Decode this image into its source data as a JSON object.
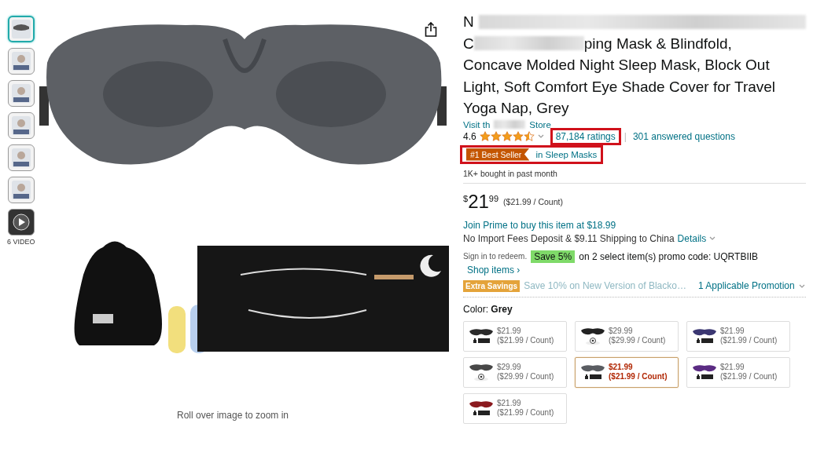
{
  "gallery": {
    "thumbnails": [
      {
        "kind": "photo",
        "selected": true
      },
      {
        "kind": "photo",
        "selected": false
      },
      {
        "kind": "photo",
        "selected": false
      },
      {
        "kind": "photo",
        "selected": false
      },
      {
        "kind": "photo",
        "selected": false
      },
      {
        "kind": "photo",
        "selected": false
      },
      {
        "kind": "video",
        "selected": false
      }
    ],
    "video_label": "6 VIDEO",
    "hint": "Roll over image to zoom in"
  },
  "product": {
    "title_lines": [
      [
        {
          "kind": "text",
          "text": "N"
        },
        {
          "kind": "blur_long"
        }
      ],
      [
        {
          "kind": "text",
          "text": "C"
        },
        {
          "kind": "blur_mid"
        },
        {
          "kind": "text",
          "text": "ping Mask & Blindfold,"
        }
      ],
      [
        {
          "kind": "text",
          "text": "Concave Molded Night Sleep Mask, Block Out"
        }
      ],
      [
        {
          "kind": "text",
          "text": "Light, Soft Comfort Eye Shade Cover for Travel"
        }
      ],
      [
        {
          "kind": "text",
          "text": "Yoga Nap, Grey"
        }
      ]
    ],
    "store_link": [
      {
        "kind": "text",
        "text": "Visit th"
      },
      {
        "kind": "blur_short"
      },
      {
        "kind": "text",
        "text": "Store"
      }
    ],
    "rating": "4.6",
    "stars": 4.5,
    "ratings_count": {
      "text": "87,184 ratings",
      "highlighted": true
    },
    "separator": "|",
    "answered": "301 answered questions",
    "badge": {
      "label": "#1 Best Seller",
      "category": "in Sleep Masks",
      "highlighted": true
    },
    "bought": "1K+ bought in past month"
  },
  "price": {
    "symbol": "$",
    "whole": "21",
    "fraction": "99",
    "unit": "($21.99 / Count)"
  },
  "prime": "Join Prime to buy this item at $18.99",
  "shipping": {
    "text": "No Import Fees Deposit & $9.11 Shipping to China",
    "link": "Details"
  },
  "promo": {
    "sign_in": "Sign in to redeem.",
    "badge": "Save 5%",
    "text": "on 2 select item(s) promo code: UQRTBIIB",
    "link": "Shop items ›"
  },
  "extra": {
    "badge": "Extra Savings",
    "text": "Save 10% on New Version of Blacko…",
    "link": "1 Applicable Promotion"
  },
  "color": {
    "label": "Color:",
    "value": "Grey"
  },
  "variants": [
    {
      "color": "#2b2b2b",
      "kind": "case",
      "price": "$21.99",
      "unit": "($21.99 / Count)",
      "selected": false
    },
    {
      "color": "#222222",
      "kind": "figure",
      "price": "$29.99",
      "unit": "($29.99 / Count)",
      "selected": false
    },
    {
      "color": "#3b3772",
      "kind": "case",
      "price": "$21.99",
      "unit": "($21.99 / Count)",
      "selected": false
    },
    {
      "color": "#474747",
      "kind": "figure",
      "price": "$29.99",
      "unit": "($29.99 / Count)",
      "selected": false
    },
    {
      "color": "#5a5d62",
      "kind": "case",
      "price": "$21.99",
      "unit": "($21.99 / Count)",
      "selected": true
    },
    {
      "color": "#5b2c83",
      "kind": "case",
      "price": "$21.99",
      "unit": "($21.99 / Count)",
      "selected": false
    },
    {
      "color": "#8b1a1f",
      "kind": "case",
      "price": "$21.99",
      "unit": "($21.99 / Count)",
      "selected": false
    }
  ]
}
